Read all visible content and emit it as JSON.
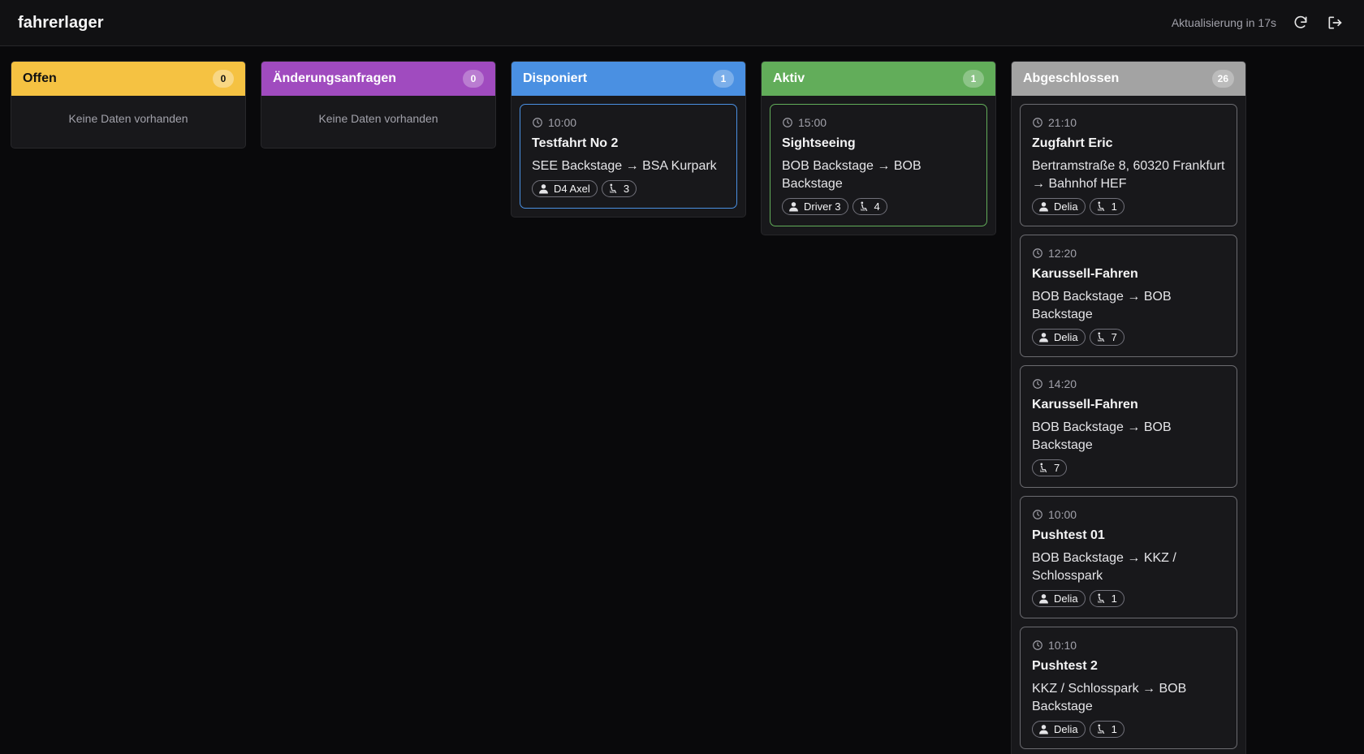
{
  "app": {
    "title": "fahrerlager"
  },
  "header": {
    "refresh_text": "Aktualisierung in 17s",
    "refresh_icon": "refresh-icon",
    "logout_icon": "logout-icon"
  },
  "colors": {
    "open": "#f5c242",
    "change": "#a04bbf",
    "dispatched": "#4a90e2",
    "active": "#62ad5a",
    "done": "#a3a3a3"
  },
  "columns": [
    {
      "title": "Offen",
      "count": "0",
      "empty_text": "Keine Daten vorhanden"
    },
    {
      "title": "Änderungsanfragen",
      "count": "0",
      "empty_text": "Keine Daten vorhanden"
    },
    {
      "title": "Disponiert",
      "count": "1",
      "cards": [
        {
          "time": "10:00",
          "title": "Testfahrt No 2",
          "route": "SEE Backstage → BSA Kurpark",
          "driver": "D4 Axel",
          "passengers": "3"
        }
      ]
    },
    {
      "title": "Aktiv",
      "count": "1",
      "cards": [
        {
          "time": "15:00",
          "title": "Sightseeing",
          "route": "BOB Backstage → BOB Backstage",
          "driver": "Driver 3",
          "passengers": "4"
        }
      ]
    },
    {
      "title": "Abgeschlossen",
      "count": "26",
      "cards": [
        {
          "time": "21:10",
          "title": "Zugfahrt Eric",
          "route": "Bertramstraße 8, 60320 Frankfurt → Bahnhof HEF",
          "driver": "Delia",
          "passengers": "1"
        },
        {
          "time": "12:20",
          "title": "Karussell-Fahren",
          "route": "BOB Backstage → BOB Backstage",
          "driver": "Delia",
          "passengers": "7"
        },
        {
          "time": "14:20",
          "title": "Karussell-Fahren",
          "route": "BOB Backstage → BOB Backstage",
          "passengers": "7"
        },
        {
          "time": "10:00",
          "title": "Pushtest 01",
          "route": "BOB Backstage → KKZ / Schlosspark",
          "driver": "Delia",
          "passengers": "1"
        },
        {
          "time": "10:10",
          "title": "Pushtest 2",
          "route": "KKZ / Schlosspark → BOB Backstage",
          "driver": "Delia",
          "passengers": "1"
        }
      ]
    }
  ]
}
